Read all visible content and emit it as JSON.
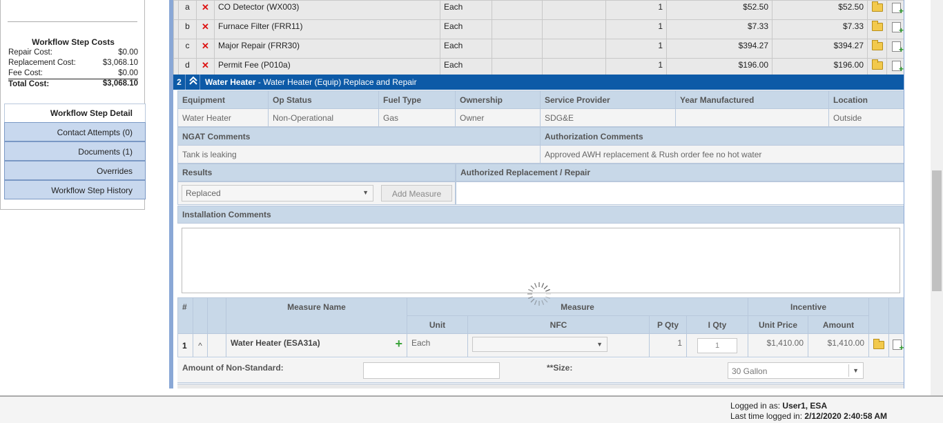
{
  "sidebar": {
    "costs_title": "Workflow Step Costs",
    "costs": [
      {
        "label": "Repair Cost:",
        "value": "$0.00"
      },
      {
        "label": "Replacement Cost:",
        "value": "$3,068.10"
      },
      {
        "label": "Fee Cost:",
        "value": "$0.00"
      }
    ],
    "total": {
      "label": "Total Cost:",
      "value": "$3,068.10"
    },
    "detail_tab": "Workflow Step Detail",
    "nav": [
      {
        "label": "Contact Attempts (0)"
      },
      {
        "label": "Documents (1)"
      },
      {
        "label": "Overrides"
      },
      {
        "label": "Workflow Step History"
      }
    ]
  },
  "items": [
    {
      "letter": "a",
      "name": "CO Detector (WX003)",
      "unit": "Each",
      "qty": "1",
      "price": "$52.50",
      "amount": "$52.50"
    },
    {
      "letter": "b",
      "name": "Furnace Filter (FRR11)",
      "unit": "Each",
      "qty": "1",
      "price": "$7.33",
      "amount": "$7.33"
    },
    {
      "letter": "c",
      "name": "Major Repair (FRR30)",
      "unit": "Each",
      "qty": "1",
      "price": "$394.27",
      "amount": "$394.27"
    },
    {
      "letter": "d",
      "name": "Permit Fee (P010a)",
      "unit": "Each",
      "qty": "1",
      "price": "$196.00",
      "amount": "$196.00"
    }
  ],
  "section": {
    "number": "2",
    "title_bold": "Water Heater",
    "title_rest": " - Water Heater (Equip) Replace and Repair"
  },
  "equipment": {
    "headers": [
      "Equipment",
      "Op Status",
      "Fuel Type",
      "Ownership",
      "Service Provider",
      "Year Manufactured",
      "Location"
    ],
    "values": [
      "Water Heater",
      "Non-Operational",
      "Gas",
      "Owner",
      "SDG&E",
      "",
      "Outside"
    ]
  },
  "comments": {
    "ngat_label": "NGAT Comments",
    "ngat_value": "Tank is leaking",
    "auth_label": "Authorization Comments",
    "auth_value": "Approved AWH replacement & Rush order fee no hot water"
  },
  "results": {
    "label": "Results",
    "selected": "Replaced",
    "add_measure": "Add Measure",
    "auth_label": "Authorized Replacement / Repair"
  },
  "installation": {
    "label": "Installation Comments",
    "value": ""
  },
  "measure_table": {
    "col_num": "#",
    "col_name": "Measure Name",
    "group_measure": "Measure",
    "group_incentive": "Incentive",
    "col_unit": "Unit",
    "col_nfc": "NFC",
    "col_pqty": "P Qty",
    "col_iqty": "I Qty",
    "col_unit_price": "Unit Price",
    "col_amount": "Amount",
    "rows": [
      {
        "num": "1",
        "name": "Water Heater (ESA31a)",
        "unit": "Each",
        "nfc": "",
        "pqty": "1",
        "iqty": "1",
        "unit_price": "$1,410.00",
        "amount": "$1,410.00"
      }
    ]
  },
  "measure_extra": {
    "nonstd_label": "Amount of Non-Standard:",
    "nonstd_value": "",
    "size_label": "**Size:",
    "size_value": "30 Gallon"
  },
  "footer": {
    "logged_in_prefix": "Logged in as: ",
    "logged_in_user": "User1, ESA",
    "last_prefix": "Last time logged in: ",
    "last_value": "2/12/2020 2:40:58 AM"
  }
}
